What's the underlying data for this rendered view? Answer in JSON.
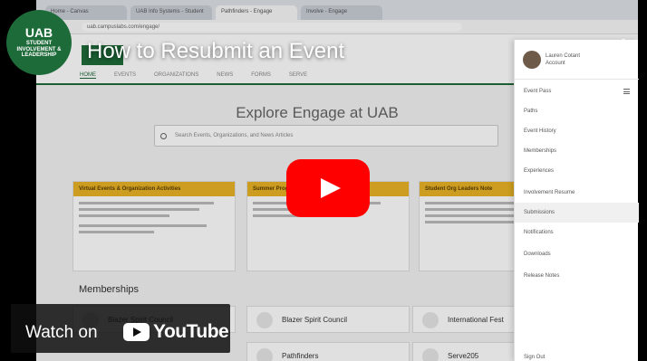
{
  "video": {
    "title": "How to Resubmit an Event",
    "watch_on_label": "Watch on",
    "platform_name": "YouTube"
  },
  "channel": {
    "logo_letters": "UAB",
    "logo_text": "STUDENT INVOLVEMENT & LEADERSHIP",
    "brand_color": "#1e6b3a"
  },
  "browser": {
    "tabs": [
      "Home - Canvas",
      "UAB Info Systems - Student",
      "Pathfinders - Engage",
      "Involve - Engage"
    ],
    "url": "uab.campuslabs.com/engage/"
  },
  "site": {
    "nav": [
      "HOME",
      "EVENTS",
      "ORGANIZATIONS",
      "NEWS",
      "FORMS",
      "SERVE"
    ],
    "explore_title": "Explore Engage at UAB",
    "search_placeholder": "Search Events, Organizations, and News Articles",
    "cards": [
      {
        "title": "Virtual Events & Organization Activities"
      },
      {
        "title": "Summer Programs"
      },
      {
        "title": "Student Org Leaders Note"
      }
    ],
    "memberships_title": "Memberships",
    "memberships": [
      "Blazer Spirit Council",
      "International Fest",
      "Pathfinders",
      "Serve205"
    ]
  },
  "menu": {
    "user_name": "Lauren Cotant",
    "user_sub": "Account",
    "items": [
      "Event Pass",
      "Paths",
      "Event History",
      "Memberships",
      "Experiences",
      "Involvement Resume",
      "Submissions",
      "Notifications",
      "Downloads",
      "Release Notes"
    ],
    "sign_out": "Sign Out"
  },
  "colors": {
    "play_button": "#ff0000",
    "card_header": "#e9b325"
  }
}
